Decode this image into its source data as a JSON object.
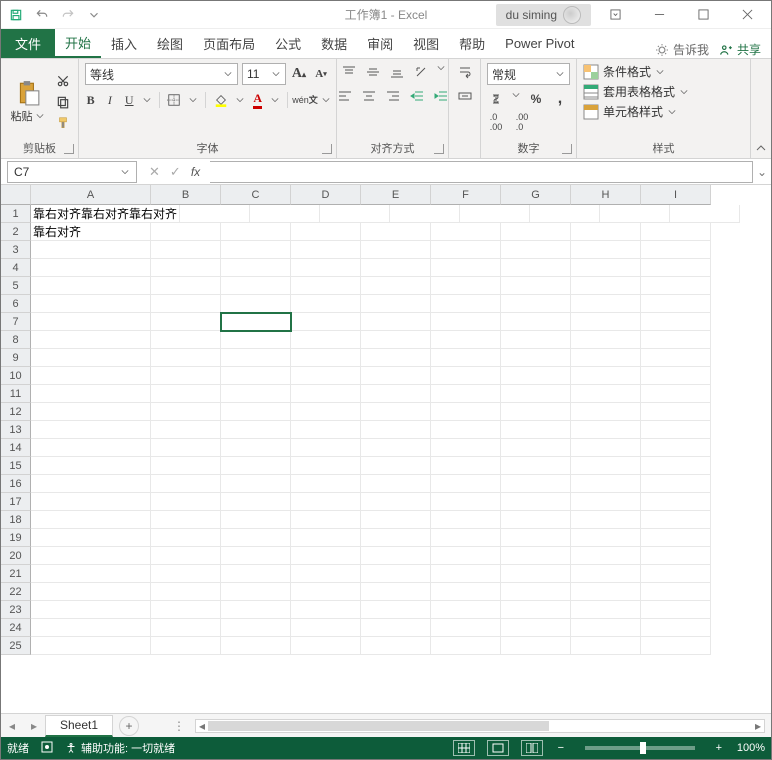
{
  "titlebar": {
    "doc_title": "工作簿1  -  Excel",
    "user": "du siming"
  },
  "tabs": {
    "file": "文件",
    "items": [
      "开始",
      "插入",
      "绘图",
      "页面布局",
      "公式",
      "数据",
      "审阅",
      "视图",
      "帮助",
      "Power Pivot"
    ],
    "tell_me": "告诉我",
    "share": "共享"
  },
  "ribbon": {
    "clipboard": {
      "paste": "粘贴",
      "label": "剪贴板"
    },
    "font": {
      "name": "等线",
      "size": "11",
      "label": "字体"
    },
    "alignment": {
      "label": "对齐方式"
    },
    "number": {
      "format": "常规",
      "label": "数字"
    },
    "styles": {
      "cond": "条件格式",
      "table": "套用表格格式",
      "cell": "单元格样式",
      "label": "样式"
    }
  },
  "formula": {
    "name": "C7",
    "fx": "fx",
    "value": ""
  },
  "grid": {
    "cols": [
      "A",
      "B",
      "C",
      "D",
      "E",
      "F",
      "G",
      "H",
      "I"
    ],
    "rows": 25,
    "cells": {
      "A1": "靠右对齐靠右对齐靠右对齐",
      "A2": "靠右对齐"
    },
    "selected": "C7"
  },
  "sheets": {
    "active": "Sheet1"
  },
  "status": {
    "ready": "就绪",
    "acc": "辅助功能: 一切就绪",
    "zoom": "100%"
  }
}
